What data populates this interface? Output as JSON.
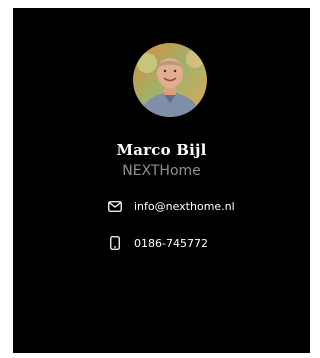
{
  "profile": {
    "name": "Marco Bijl",
    "company": "NEXTHome",
    "avatar_alt": "Marco Bijl"
  },
  "contact": {
    "email": {
      "icon": "mail-icon",
      "text": "info@nexthome.nl"
    },
    "phone": {
      "icon": "phone-icon",
      "text": "0186-745772"
    }
  },
  "colors": {
    "card_background": "#000000",
    "name_text": "#ffffff",
    "company_text": "#8f8f8f",
    "contact_text": "#ffffff"
  }
}
